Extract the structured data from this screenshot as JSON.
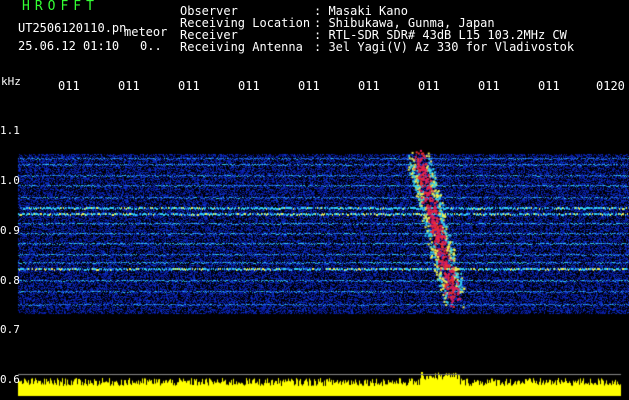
{
  "header": {
    "app_title": "HROFFT",
    "filename": "UT2506120110.pn",
    "meteor_label": "meteor",
    "timestamp": "25.06.12 01:10",
    "suffix": "0.."
  },
  "info": {
    "observer_label": "Observer",
    "observer_value": ": Masaki Kano",
    "location_label": "Receiving Location",
    "location_value": ": Shibukawa, Gunma, Japan",
    "receiver_label": "Receiver",
    "receiver_value": ": RTL-SDR SDR# 43dB L15 103.2MHz CW",
    "antenna_label": "Receiving Antenna",
    "antenna_value": ": 3el Yagi(V) Az 330 for Vladivostok"
  },
  "axis": {
    "y_unit": "kHz",
    "y_ticks": [
      "1.1",
      "1.0",
      "0.9",
      "0.8",
      "0.7",
      "0.6"
    ],
    "time_ticks": [
      "011",
      "011",
      "011",
      "011",
      "011",
      "011",
      "011",
      "011",
      "011",
      "0120"
    ]
  },
  "colors": {
    "title_green": "#33ff33",
    "background": "#000000",
    "noise_floor_blue": "#0a1fa8",
    "signal_cyan": "#32d2f0",
    "signal_yellow": "#f0f050",
    "signal_red": "#f03030",
    "echo_magenta": "#e01e5a",
    "level_bar_yellow": "#ffff00"
  }
}
